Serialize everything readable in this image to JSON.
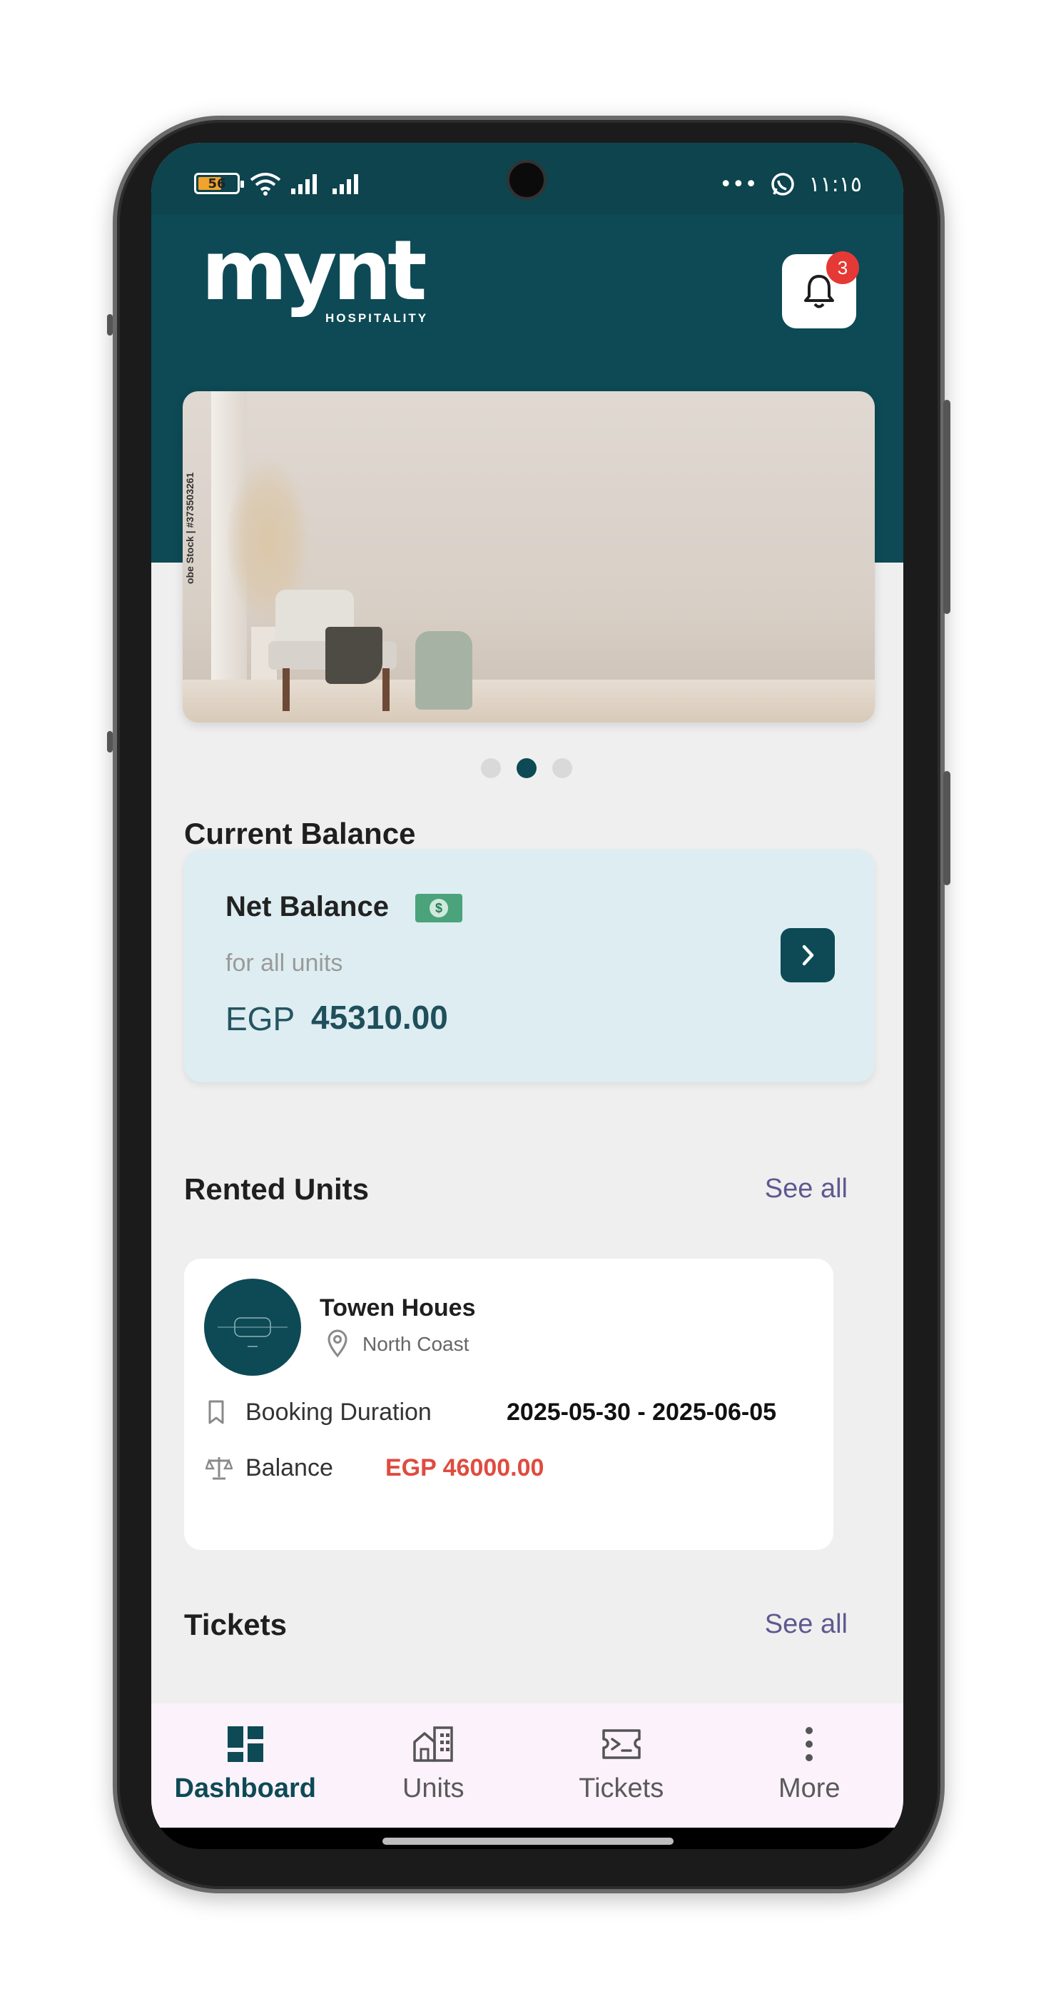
{
  "status_bar": {
    "battery": "56",
    "time": "١١:١٥",
    "more": "•••"
  },
  "header": {
    "logo": "mynt",
    "logo_sub": "HOSPITALITY",
    "notification_count": "3"
  },
  "banner": {
    "watermark": "obe Stock | #373503261",
    "dot_count": 3,
    "active_dot": 2
  },
  "balance": {
    "section_title": "Current Balance",
    "card_title": "Net Balance",
    "subtitle": "for all units",
    "currency": "EGP",
    "amount": "45310.00"
  },
  "rented_units": {
    "section_title": "Rented Units",
    "see_all": "See all",
    "unit": {
      "name": "Towen Houes",
      "location": "North Coast",
      "booking_label": "Booking Duration",
      "booking_value": "2025-05-30 - 2025-06-05",
      "balance_label": "Balance",
      "balance_value": "EGP 46000.00"
    }
  },
  "tickets": {
    "section_title": "Tickets",
    "see_all": "See all"
  },
  "nav": {
    "items": [
      {
        "label": "Dashboard",
        "icon": "dashboard-icon",
        "active": true
      },
      {
        "label": "Units",
        "icon": "building-icon",
        "active": false
      },
      {
        "label": "Tickets",
        "icon": "ticket-icon",
        "active": false
      },
      {
        "label": "More",
        "icon": "more-vertical-icon",
        "active": false
      }
    ]
  },
  "colors": {
    "brand_teal": "#0d4a55",
    "card_blue": "#ddedf2",
    "balance_red": "#e04b3f",
    "link_purple": "#5f5890",
    "badge_red": "#e53935"
  }
}
